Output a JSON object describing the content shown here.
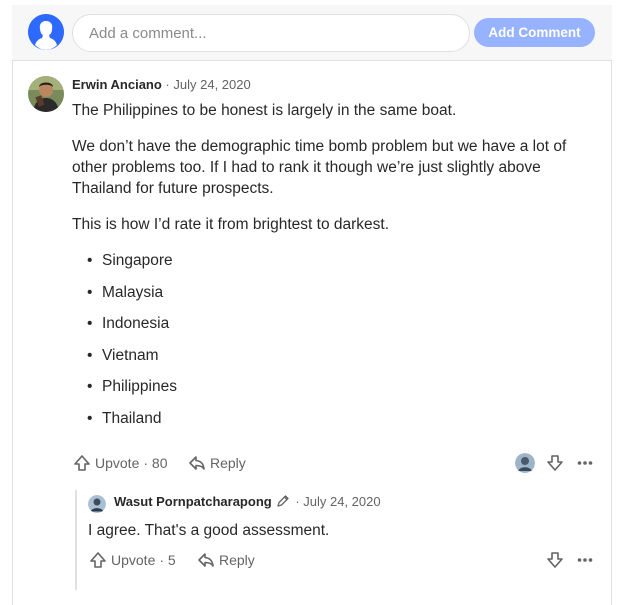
{
  "add_comment": {
    "placeholder": "Add a comment...",
    "button_label": "Add Comment"
  },
  "comments": [
    {
      "author": "Erwin Anciano",
      "separator": " · ",
      "date": "July 24, 2020",
      "paragraphs": [
        "The Philippines to be honest is largely in the same boat.",
        "We don’t have the demographic time bomb problem but we have a lot of other problems too. If I had to rank it though we’re just slightly above Thailand for future prospects.",
        "This is how I’d rate it from brightest to darkest."
      ],
      "list": [
        "Singapore",
        "Malaysia",
        "Indonesia",
        "Vietnam",
        "Philippines",
        "Thailand"
      ],
      "upvote_label": "Upvote",
      "upvote_count": "· 80",
      "reply_label": "Reply"
    },
    {
      "author": "Wasut Pornpatcharapong",
      "separator": " · ",
      "date": "July 24, 2020",
      "text": "I agree. That's a good assessment.",
      "upvote_label": "Upvote",
      "upvote_count": "· 5",
      "reply_label": "Reply"
    }
  ],
  "icons": {
    "upvote": "upvote-arrow-icon",
    "reply": "reply-arrow-icon",
    "downvote": "downvote-arrow-icon",
    "more": "more-options-icon",
    "pencil": "pencil-icon"
  },
  "colors": {
    "accent": "#2e69ff",
    "button_disabled": "#97b3ff",
    "text": "#282829",
    "meta": "#636466",
    "border": "#dee0e1"
  }
}
